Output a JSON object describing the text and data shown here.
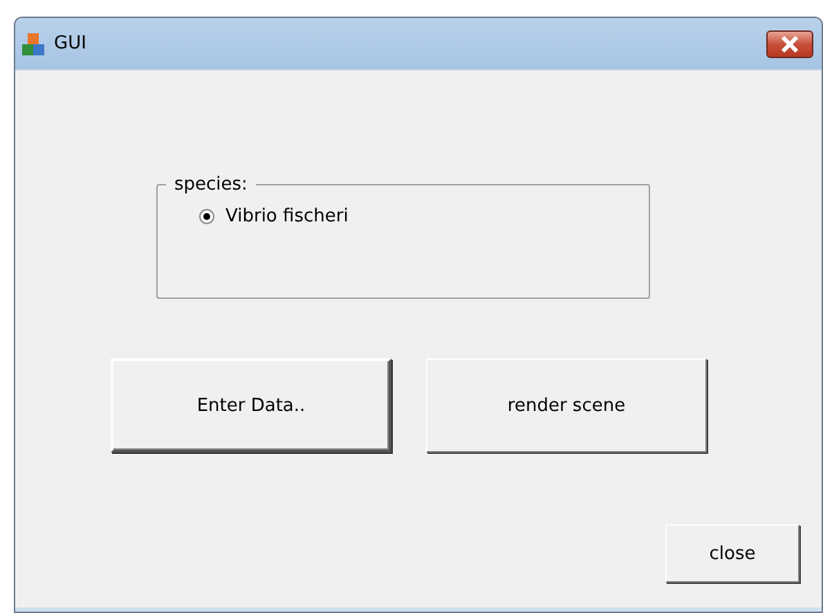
{
  "window": {
    "title": "GUI"
  },
  "species_group": {
    "label": "species:",
    "options": [
      {
        "label": "Vibrio fischeri",
        "selected": true
      }
    ]
  },
  "buttons": [
    {
      "label": "Enter Data..",
      "default": true
    },
    {
      "label": "render scene",
      "default": false
    }
  ],
  "close_button": {
    "label": "close"
  }
}
